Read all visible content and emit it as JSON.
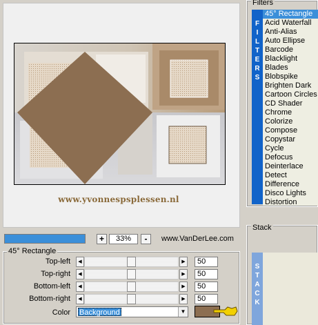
{
  "preview": {
    "watermark": "www.yvonnespsplessen.nl",
    "diamond_color": "#8c6e51"
  },
  "zoom": {
    "plus_label": "+",
    "value": "33%",
    "minus_label": "-",
    "link": "www.VanDerLee.com"
  },
  "settings": {
    "group_title": "45° Rectangle",
    "sliders": [
      {
        "label": "Top-left",
        "value": "50"
      },
      {
        "label": "Top-right",
        "value": "50"
      },
      {
        "label": "Bottom-left",
        "value": "50"
      },
      {
        "label": "Bottom-right",
        "value": "50"
      }
    ],
    "color_label": "Color",
    "color_value": "Background",
    "swatch_color": "#8c6e51"
  },
  "filters": {
    "title": "Filters",
    "banner": [
      "F",
      "I",
      "L",
      "T",
      "E",
      "R",
      "S"
    ],
    "items": [
      "45° Rectangle",
      "Acid Waterfall",
      "Anti-Alias",
      "Auto Ellipse",
      "Barcode",
      "Blacklight",
      "Blades",
      "Blobspike",
      "Brighten Dark",
      "Cartoon Circles",
      "CD Shader",
      "Chrome",
      "Colorize",
      "Compose",
      "Copystar",
      "Cycle",
      "Defocus",
      "Deinterlace",
      "Detect",
      "Difference",
      "Disco Lights",
      "Distortion"
    ],
    "selected_index": 0
  },
  "stack": {
    "title": "Stack",
    "banner": [
      "S",
      "T",
      "A",
      "C",
      "K"
    ]
  }
}
